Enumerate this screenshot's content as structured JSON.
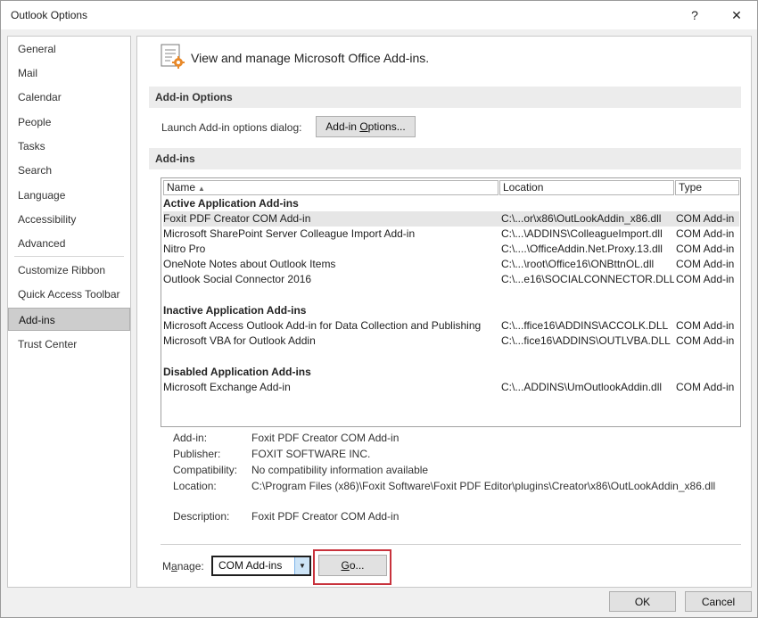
{
  "window": {
    "title": "Outlook Options",
    "help_label": "?",
    "close_label": "✕"
  },
  "nav": {
    "items": [
      {
        "label": "General"
      },
      {
        "label": "Mail"
      },
      {
        "label": "Calendar"
      },
      {
        "label": "People"
      },
      {
        "label": "Tasks"
      },
      {
        "label": "Search"
      },
      {
        "label": "Language"
      },
      {
        "label": "Accessibility"
      },
      {
        "label": "Advanced"
      },
      {
        "label": "Customize Ribbon"
      },
      {
        "label": "Quick Access Toolbar"
      },
      {
        "label": "Add-ins"
      },
      {
        "label": "Trust Center"
      }
    ],
    "selected": "Add-ins"
  },
  "header": {
    "text": "View and manage Microsoft Office Add-ins.",
    "icon": "addins-gear-icon"
  },
  "addin_options": {
    "section_title": "Add-in Options",
    "launch_label": "Launch Add-in options dialog:",
    "button_pre": "Add-in ",
    "button_accel": "O",
    "button_post": "ptions..."
  },
  "addins": {
    "section_title": "Add-ins",
    "columns": {
      "name": "Name",
      "location": "Location",
      "type": "Type"
    },
    "active": {
      "title": "Active Application Add-ins",
      "rows": [
        {
          "name": "Foxit PDF Creator COM Add-in",
          "location": "C:\\...or\\x86\\OutLookAddin_x86.dll",
          "type": "COM Add-in"
        },
        {
          "name": "Microsoft SharePoint Server Colleague Import Add-in",
          "location": "C:\\...\\ADDINS\\ColleagueImport.dll",
          "type": "COM Add-in"
        },
        {
          "name": "Nitro Pro",
          "location": "C:\\....\\OfficeAddin.Net.Proxy.13.dll",
          "type": "COM Add-in"
        },
        {
          "name": "OneNote Notes about Outlook Items",
          "location": "C:\\...\\root\\Office16\\ONBttnOL.dll",
          "type": "COM Add-in"
        },
        {
          "name": "Outlook Social Connector 2016",
          "location": "C:\\...e16\\SOCIALCONNECTOR.DLL",
          "type": "COM Add-in"
        }
      ]
    },
    "inactive": {
      "title": "Inactive Application Add-ins",
      "rows": [
        {
          "name": "Microsoft Access Outlook Add-in for Data Collection and Publishing",
          "location": "C:\\...ffice16\\ADDINS\\ACCOLK.DLL",
          "type": "COM Add-in"
        },
        {
          "name": "Microsoft VBA for Outlook Addin",
          "location": "C:\\...fice16\\ADDINS\\OUTLVBA.DLL",
          "type": "COM Add-in"
        }
      ]
    },
    "disabled": {
      "title": "Disabled Application Add-ins",
      "rows": [
        {
          "name": "Microsoft Exchange Add-in",
          "location": "C:\\...ADDINS\\UmOutlookAddin.dll",
          "type": "COM Add-in"
        }
      ]
    }
  },
  "details": {
    "addin_label": "Add-in:",
    "addin_value": "Foxit PDF Creator COM Add-in",
    "publisher_label": "Publisher:",
    "publisher_value": "FOXIT SOFTWARE INC.",
    "compat_label": "Compatibility:",
    "compat_value": "No compatibility information available",
    "location_label": "Location:",
    "location_value": "C:\\Program Files (x86)\\Foxit Software\\Foxit PDF Editor\\plugins\\Creator\\x86\\OutLookAddin_x86.dll",
    "desc_label": "Description:",
    "desc_value": "Foxit PDF Creator COM Add-in"
  },
  "manage": {
    "label_pre": "M",
    "label_accel": "a",
    "label_post": "nage:",
    "selected": "COM Add-ins",
    "go_accel": "G",
    "go_post": "o..."
  },
  "footer": {
    "ok_label": "OK",
    "cancel_label": "Cancel"
  },
  "colors": {
    "highlight_border": "#c8323c",
    "selected_nav": "#cdcdcd",
    "dropdown_arrow": "#cde4f7"
  }
}
